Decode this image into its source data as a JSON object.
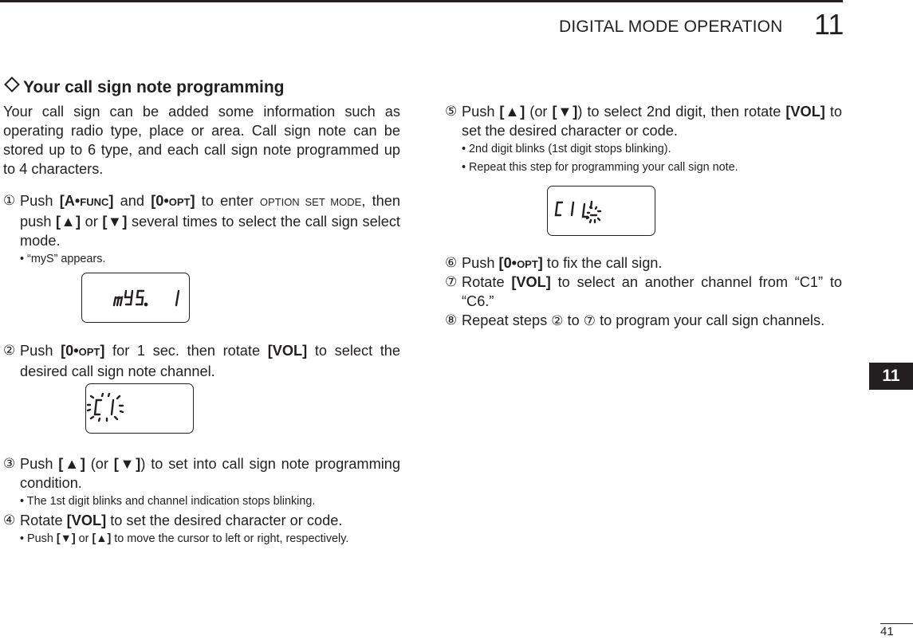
{
  "header": {
    "chapter_title": "DIGITAL MODE OPERATION",
    "chapter_number": "11"
  },
  "section": {
    "title": "Your call sign note programming",
    "intro": "Your call sign can be added some information such as operating radio type, place or area. Call sign note can be stored up to 6 type, and each call sign note programmed up to 4 characters."
  },
  "steps": [
    {
      "marker": "①",
      "parts": [
        "Push ",
        "[A•",
        "FUNC",
        "]",
        " and ",
        "[0•",
        "OPT",
        "]",
        " to enter ",
        "OPTION SET MODE",
        ", then push ",
        "[▲]",
        " or ",
        "[▼]",
        " several times to select the call sign select mode."
      ],
      "notes": [
        "• “myS” appears."
      ],
      "lcd": "mYS. 1"
    },
    {
      "marker": "②",
      "parts": [
        "Push ",
        "[0•",
        "OPT",
        "]",
        " for 1 sec. then rotate ",
        "[VOL]",
        " to select the desired call sign note channel."
      ],
      "notes": [],
      "lcd": "C1 (blinking)"
    },
    {
      "marker": "③",
      "parts": [
        "Push ",
        "[▲]",
        " (or ",
        "[▼]",
        ") to set into call sign note programming condition."
      ],
      "notes": [
        "• The 1st digit blinks and channel indication stops blinking."
      ]
    },
    {
      "marker": "④",
      "parts": [
        "Rotate ",
        "[VOL]",
        " to set the desired character or code."
      ],
      "notes": [
        "• Push ",
        "[▼]",
        " or ",
        "[▲]",
        " to move the cursor to left or right, respectively."
      ]
    },
    {
      "marker": "⑤",
      "parts": [
        "Push ",
        "[▲]",
        " (or ",
        "[▼]",
        ") to select 2nd digit, then rotate ",
        "[VOL]",
        " to set the desired character or code."
      ],
      "notes": [
        "• 2nd digit blinks (1st digit stops blinking).",
        "• Repeat this step for programming your call sign note."
      ],
      "lcd": "C1 L_ (2nd digit blinking)"
    },
    {
      "marker": "⑥",
      "parts": [
        "Push ",
        "[0•",
        "OPT",
        "]",
        " to fix the call sign."
      ],
      "notes": []
    },
    {
      "marker": "⑦",
      "parts": [
        "Rotate ",
        "[VOL]",
        " to select an another channel from “C1” to “C6.”"
      ],
      "notes": []
    },
    {
      "marker": "⑧",
      "parts": [
        "Repeat steps ",
        "②",
        " to ",
        "⑦",
        " to program your call sign channels."
      ],
      "notes": []
    }
  ],
  "side_tab": "11",
  "page_number": "41"
}
